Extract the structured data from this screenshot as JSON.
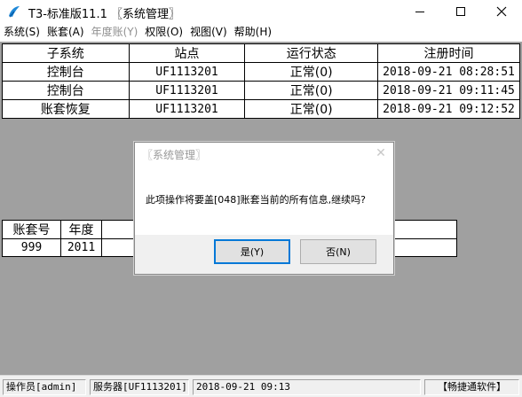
{
  "window": {
    "title": "T3-标准版11.1 〖系统管理〗",
    "icon": "app-icon",
    "controls": [
      "minimize",
      "maximize",
      "close"
    ]
  },
  "menu": [
    {
      "label": "系统(S)",
      "enabled": true
    },
    {
      "label": "账套(A)",
      "enabled": true
    },
    {
      "label": "年度账(Y)",
      "enabled": false
    },
    {
      "label": "权限(O)",
      "enabled": true
    },
    {
      "label": "视图(V)",
      "enabled": true
    },
    {
      "label": "帮助(H)",
      "enabled": true
    }
  ],
  "sessions_table": {
    "headers": [
      "子系统",
      "站点",
      "运行状态",
      "注册时间"
    ],
    "rows": [
      [
        "控制台",
        "UF1113201",
        "正常(0)",
        "2018-09-21 08:28:51"
      ],
      [
        "控制台",
        "UF1113201",
        "正常(0)",
        "2018-09-21 09:11:45"
      ],
      [
        "账套恢复",
        "UF1113201",
        "正常(0)",
        "2018-09-21 09:12:52"
      ]
    ]
  },
  "accounts_table": {
    "headers": [
      "账套号",
      "年度"
    ],
    "rows": [
      [
        "999",
        "2011"
      ]
    ]
  },
  "dialog": {
    "title": "〖系统管理〗",
    "message": "此项操作将要盖[048]账套当前的所有信息,继续吗?",
    "yes_label": "是(Y)",
    "no_label": "否(N)",
    "close_glyph": "✕"
  },
  "status": {
    "operator": "操作员[admin]",
    "server": "服务器[UF1113201]",
    "datetime": "2018-09-21 09:13",
    "brand": "【畅捷通软件】"
  },
  "colors": {
    "client_background": "#a0a0a0",
    "dialog_default_button_border": "#0078d7",
    "app_icon": "#1e88d8"
  }
}
